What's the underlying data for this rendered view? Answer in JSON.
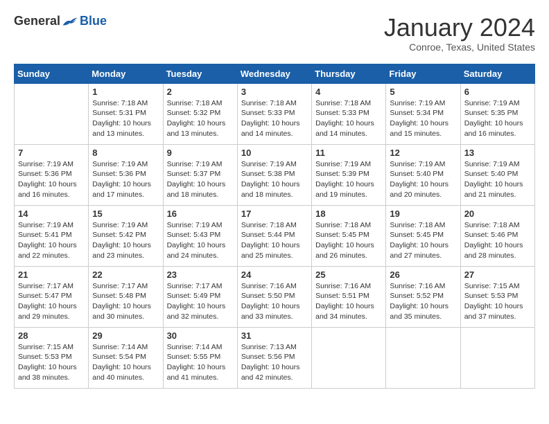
{
  "logo": {
    "general": "General",
    "blue": "Blue"
  },
  "title": "January 2024",
  "location": "Conroe, Texas, United States",
  "headers": [
    "Sunday",
    "Monday",
    "Tuesday",
    "Wednesday",
    "Thursday",
    "Friday",
    "Saturday"
  ],
  "weeks": [
    [
      {
        "day": "",
        "info": ""
      },
      {
        "day": "1",
        "info": "Sunrise: 7:18 AM\nSunset: 5:31 PM\nDaylight: 10 hours\nand 13 minutes."
      },
      {
        "day": "2",
        "info": "Sunrise: 7:18 AM\nSunset: 5:32 PM\nDaylight: 10 hours\nand 13 minutes."
      },
      {
        "day": "3",
        "info": "Sunrise: 7:18 AM\nSunset: 5:33 PM\nDaylight: 10 hours\nand 14 minutes."
      },
      {
        "day": "4",
        "info": "Sunrise: 7:18 AM\nSunset: 5:33 PM\nDaylight: 10 hours\nand 14 minutes."
      },
      {
        "day": "5",
        "info": "Sunrise: 7:19 AM\nSunset: 5:34 PM\nDaylight: 10 hours\nand 15 minutes."
      },
      {
        "day": "6",
        "info": "Sunrise: 7:19 AM\nSunset: 5:35 PM\nDaylight: 10 hours\nand 16 minutes."
      }
    ],
    [
      {
        "day": "7",
        "info": "Sunrise: 7:19 AM\nSunset: 5:36 PM\nDaylight: 10 hours\nand 16 minutes."
      },
      {
        "day": "8",
        "info": "Sunrise: 7:19 AM\nSunset: 5:36 PM\nDaylight: 10 hours\nand 17 minutes."
      },
      {
        "day": "9",
        "info": "Sunrise: 7:19 AM\nSunset: 5:37 PM\nDaylight: 10 hours\nand 18 minutes."
      },
      {
        "day": "10",
        "info": "Sunrise: 7:19 AM\nSunset: 5:38 PM\nDaylight: 10 hours\nand 18 minutes."
      },
      {
        "day": "11",
        "info": "Sunrise: 7:19 AM\nSunset: 5:39 PM\nDaylight: 10 hours\nand 19 minutes."
      },
      {
        "day": "12",
        "info": "Sunrise: 7:19 AM\nSunset: 5:40 PM\nDaylight: 10 hours\nand 20 minutes."
      },
      {
        "day": "13",
        "info": "Sunrise: 7:19 AM\nSunset: 5:40 PM\nDaylight: 10 hours\nand 21 minutes."
      }
    ],
    [
      {
        "day": "14",
        "info": "Sunrise: 7:19 AM\nSunset: 5:41 PM\nDaylight: 10 hours\nand 22 minutes."
      },
      {
        "day": "15",
        "info": "Sunrise: 7:19 AM\nSunset: 5:42 PM\nDaylight: 10 hours\nand 23 minutes."
      },
      {
        "day": "16",
        "info": "Sunrise: 7:19 AM\nSunset: 5:43 PM\nDaylight: 10 hours\nand 24 minutes."
      },
      {
        "day": "17",
        "info": "Sunrise: 7:18 AM\nSunset: 5:44 PM\nDaylight: 10 hours\nand 25 minutes."
      },
      {
        "day": "18",
        "info": "Sunrise: 7:18 AM\nSunset: 5:45 PM\nDaylight: 10 hours\nand 26 minutes."
      },
      {
        "day": "19",
        "info": "Sunrise: 7:18 AM\nSunset: 5:45 PM\nDaylight: 10 hours\nand 27 minutes."
      },
      {
        "day": "20",
        "info": "Sunrise: 7:18 AM\nSunset: 5:46 PM\nDaylight: 10 hours\nand 28 minutes."
      }
    ],
    [
      {
        "day": "21",
        "info": "Sunrise: 7:17 AM\nSunset: 5:47 PM\nDaylight: 10 hours\nand 29 minutes."
      },
      {
        "day": "22",
        "info": "Sunrise: 7:17 AM\nSunset: 5:48 PM\nDaylight: 10 hours\nand 30 minutes."
      },
      {
        "day": "23",
        "info": "Sunrise: 7:17 AM\nSunset: 5:49 PM\nDaylight: 10 hours\nand 32 minutes."
      },
      {
        "day": "24",
        "info": "Sunrise: 7:16 AM\nSunset: 5:50 PM\nDaylight: 10 hours\nand 33 minutes."
      },
      {
        "day": "25",
        "info": "Sunrise: 7:16 AM\nSunset: 5:51 PM\nDaylight: 10 hours\nand 34 minutes."
      },
      {
        "day": "26",
        "info": "Sunrise: 7:16 AM\nSunset: 5:52 PM\nDaylight: 10 hours\nand 35 minutes."
      },
      {
        "day": "27",
        "info": "Sunrise: 7:15 AM\nSunset: 5:53 PM\nDaylight: 10 hours\nand 37 minutes."
      }
    ],
    [
      {
        "day": "28",
        "info": "Sunrise: 7:15 AM\nSunset: 5:53 PM\nDaylight: 10 hours\nand 38 minutes."
      },
      {
        "day": "29",
        "info": "Sunrise: 7:14 AM\nSunset: 5:54 PM\nDaylight: 10 hours\nand 40 minutes."
      },
      {
        "day": "30",
        "info": "Sunrise: 7:14 AM\nSunset: 5:55 PM\nDaylight: 10 hours\nand 41 minutes."
      },
      {
        "day": "31",
        "info": "Sunrise: 7:13 AM\nSunset: 5:56 PM\nDaylight: 10 hours\nand 42 minutes."
      },
      {
        "day": "",
        "info": ""
      },
      {
        "day": "",
        "info": ""
      },
      {
        "day": "",
        "info": ""
      }
    ]
  ]
}
